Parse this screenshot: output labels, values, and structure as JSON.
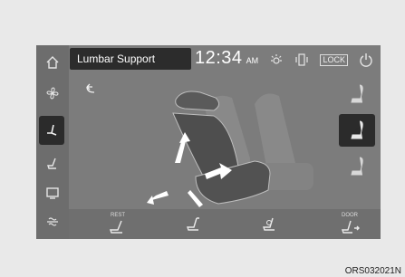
{
  "header": {
    "title": "Lumbar Support",
    "time": "12:34",
    "ampm": "AM",
    "lock_label": "LOCK"
  },
  "rail": {
    "items": [
      {
        "icon": "home-icon"
      },
      {
        "icon": "fan-icon"
      },
      {
        "icon": "seat-icon",
        "active": true
      },
      {
        "icon": "seat-recline-icon"
      },
      {
        "icon": "screen-icon"
      },
      {
        "icon": "heater-icon"
      }
    ]
  },
  "bottom_buttons": [
    {
      "label": "REST",
      "icon": "rest-seat-icon"
    },
    {
      "label": "",
      "icon": "seat-top-icon"
    },
    {
      "label": "",
      "icon": "seat-massage-icon"
    },
    {
      "label": "DOOR",
      "icon": "door-seat-icon"
    }
  ],
  "thumbnails": [
    {
      "icon": "seat-thumb-1-icon"
    },
    {
      "icon": "seat-thumb-2-icon",
      "active": true
    },
    {
      "icon": "seat-thumb-3-icon"
    }
  ],
  "caption": "ORS032021N",
  "colors": {
    "screen_bg": "#7c7c7c",
    "active_bg": "#2b2b2b",
    "arrow": "#ffffff"
  }
}
